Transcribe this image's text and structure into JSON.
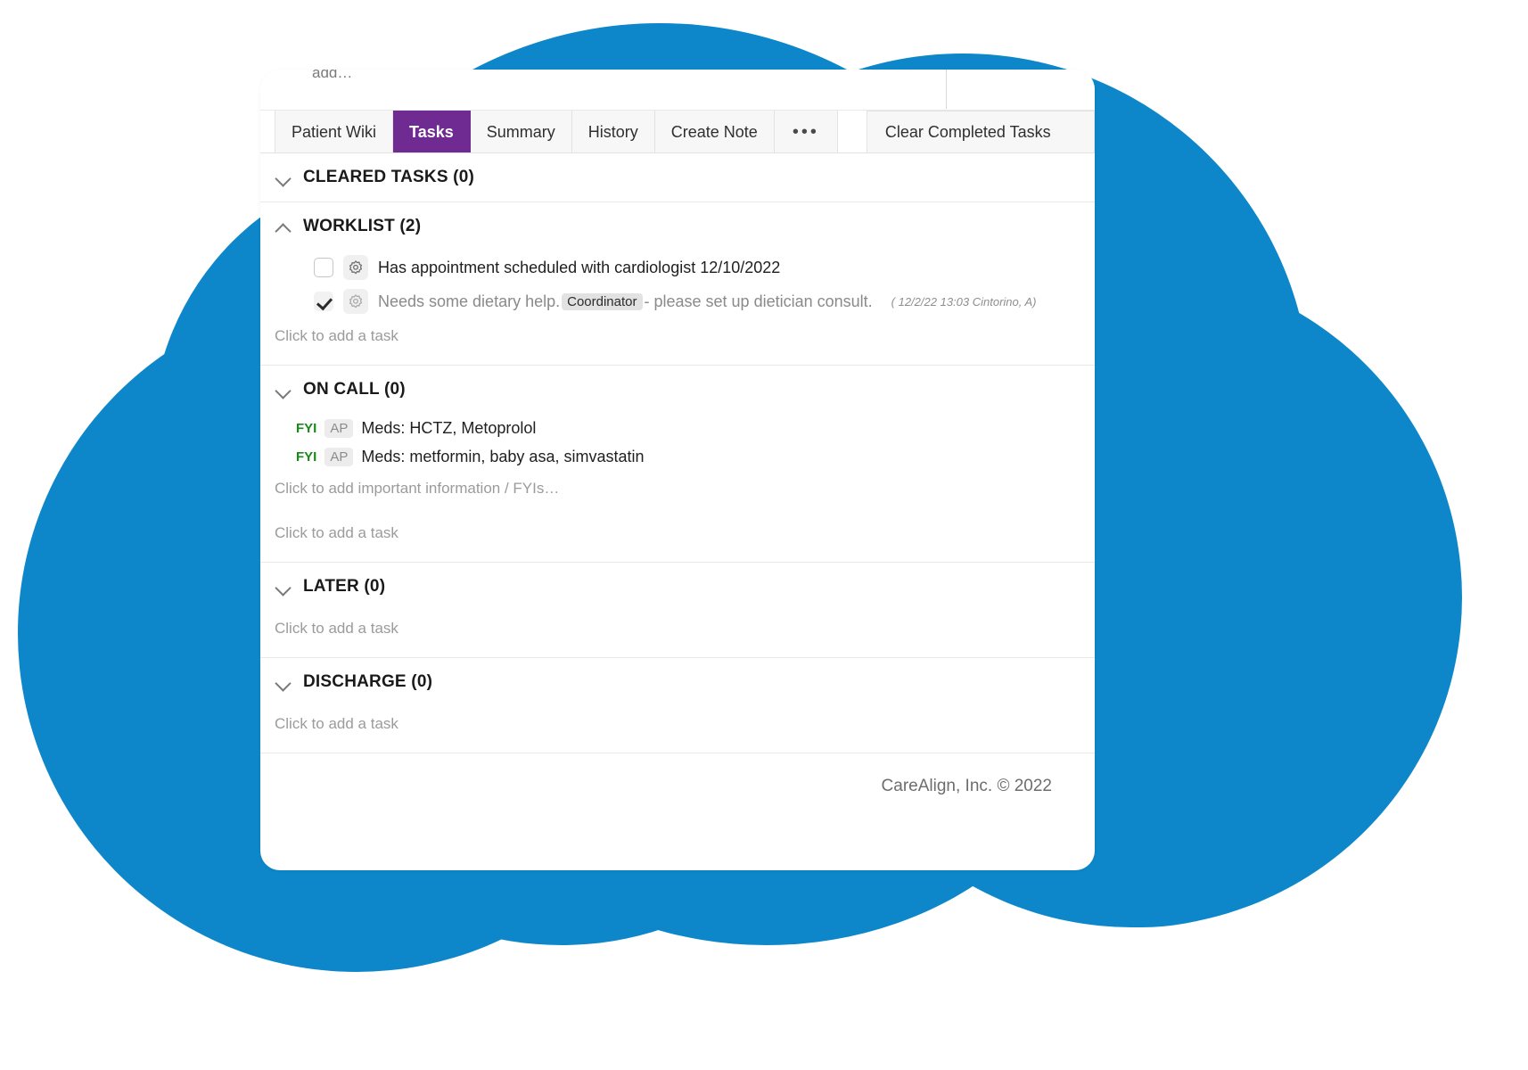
{
  "theme": {
    "blob_blue": "#0d87c9",
    "active_tab_purple": "#6f2b92",
    "fyi_green": "#188a18",
    "card_bg": "#ffffff"
  },
  "top_strip": {
    "clipped_text": "add…"
  },
  "tabs": [
    {
      "label": "Patient Wiki",
      "active": false,
      "name": "tab-patient-wiki"
    },
    {
      "label": "Tasks",
      "active": true,
      "name": "tab-tasks"
    },
    {
      "label": "Summary",
      "active": false,
      "name": "tab-summary"
    },
    {
      "label": "History",
      "active": false,
      "name": "tab-history"
    },
    {
      "label": "Create Note",
      "active": false,
      "name": "tab-create-note"
    },
    {
      "label": "•••",
      "active": false,
      "name": "tab-more-options"
    }
  ],
  "toolbar": {
    "clear_completed_label": "Clear Completed Tasks"
  },
  "sections": {
    "cleared_tasks": {
      "title": "CLEARED TASKS (0)",
      "expanded": false
    },
    "worklist": {
      "title": "WORKLIST (2)",
      "expanded": true,
      "tasks": [
        {
          "checked": false,
          "icon": "gear-icon",
          "text": "Has appointment scheduled with cardiologist 12/10/2022",
          "chip": null,
          "text_after_chip": null,
          "stamp": null
        },
        {
          "checked": true,
          "icon": "gear-icon",
          "text": "Needs some dietary help.",
          "chip": "Coordinator",
          "text_after_chip": "- please set up dietician consult.",
          "stamp": "( 12/2/22 13:03 Cintorino, A)"
        }
      ],
      "add_task_placeholder": "Click to add a task"
    },
    "on_call": {
      "title": "ON CALL (0)",
      "expanded": false,
      "fyis": [
        {
          "tag": "FYI",
          "badge": "AP",
          "text": "Meds: HCTZ, Metoprolol"
        },
        {
          "tag": "FYI",
          "badge": "AP",
          "text": "Meds: metformin, baby asa, simvastatin"
        }
      ],
      "add_fyi_placeholder": "Click to add important information / FYIs…",
      "add_task_placeholder": "Click to add a task"
    },
    "later": {
      "title": "LATER (0)",
      "expanded": false,
      "add_task_placeholder": "Click to add a task"
    },
    "discharge": {
      "title": "DISCHARGE (0)",
      "expanded": false,
      "add_task_placeholder": "Click to add a task"
    }
  },
  "footer": {
    "copyright": "CareAlign, Inc. © 2022"
  }
}
